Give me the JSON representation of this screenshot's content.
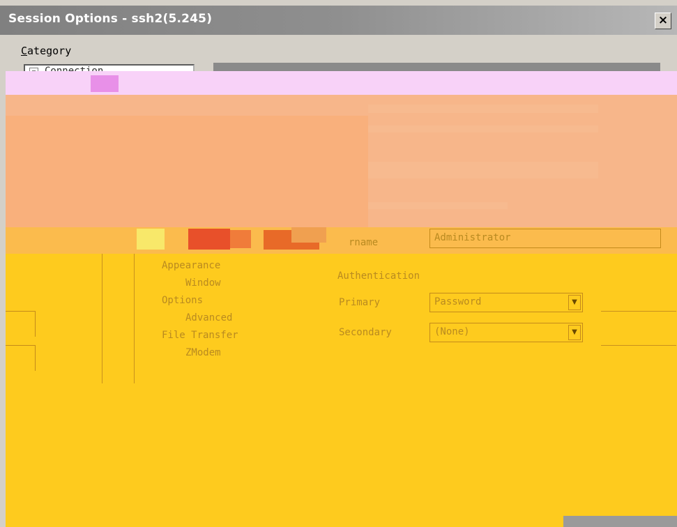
{
  "window": {
    "title": "Session Options - ssh2(5.245)",
    "close_glyph": "×"
  },
  "category": {
    "label_prefix": "C",
    "label_rest": "ategory",
    "tree_collapse_glyph": "−",
    "tree_top_text": "Connection"
  },
  "tree_items": [
    {
      "label": "Appearance"
    },
    {
      "label": "Window"
    },
    {
      "label": "Options"
    },
    {
      "label": "Advanced"
    },
    {
      "label": "File Transfer"
    },
    {
      "label": "ZModem"
    }
  ],
  "login": {
    "username_label": "rname",
    "username_value": "Administrator"
  },
  "authentication": {
    "group_label": "Authentication",
    "primary_label": "Primary",
    "primary_value": "Password",
    "secondary_label": "Secondary",
    "secondary_value": "(None)",
    "dropdown_glyph": "▼"
  },
  "colors": {
    "window_bg": "#d4d0c8",
    "glitch_pink": "#f8d2f8",
    "glitch_peach": "#f7b68a",
    "glitch_yellow": "#fecb1e"
  }
}
